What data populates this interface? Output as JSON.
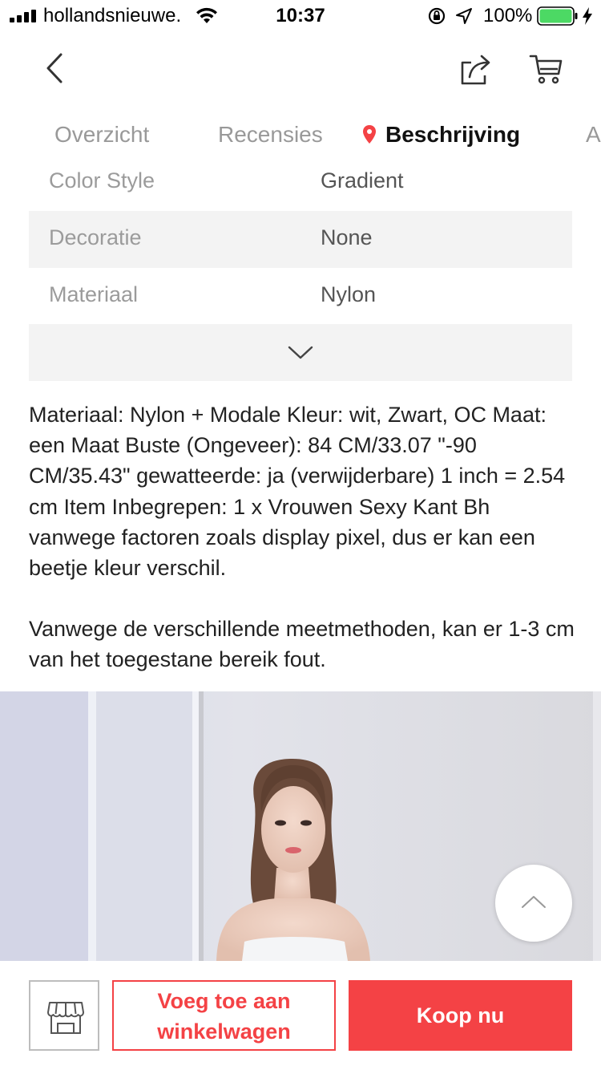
{
  "status_bar": {
    "carrier": "hollandsnieuwe.",
    "time": "10:37",
    "battery_percent": "100%",
    "battery_level": 1.0,
    "battery_color": "#4cd964"
  },
  "nav": {
    "back_icon": "chevron-left-icon",
    "share_icon": "share-icon",
    "cart_icon": "cart-icon"
  },
  "tabs": [
    {
      "label": "Overzicht",
      "active": false
    },
    {
      "label": "Recensies",
      "active": false
    },
    {
      "label": "Beschrijving",
      "active": true
    },
    {
      "label": "A",
      "active": false
    }
  ],
  "specs": [
    {
      "key": "Color Style",
      "value": "Gradient"
    },
    {
      "key": "Decoratie",
      "value": "None"
    },
    {
      "key": "Materiaal",
      "value": "Nylon"
    }
  ],
  "description": {
    "paragraph1": "Materiaal: Nylon + Modale Kleur: wit, Zwart, OC Maat: een Maat Buste (Ongeveer): 84 CM/33.07 \"-90 CM/35.43\" gewatteerde: ja (verwijderbare) 1 inch = 2.54 cm Item Inbegrepen: 1 x Vrouwen Sexy Kant Bh vanwege factoren zoals display pixel, dus er kan een beetje kleur verschil.",
    "paragraph2": "Vanwege de verschillende meetmethoden, kan er 1-3 cm van het toegestane bereik fout."
  },
  "bottom_bar": {
    "store_icon": "store-icon",
    "add_to_cart_line1": "Voeg toe aan",
    "add_to_cart_line2": "winkelwagen",
    "buy_now": "Koop nu"
  },
  "colors": {
    "accent": "#f44245",
    "muted_text": "#9b9b9b",
    "row_shade": "#f3f3f3"
  }
}
